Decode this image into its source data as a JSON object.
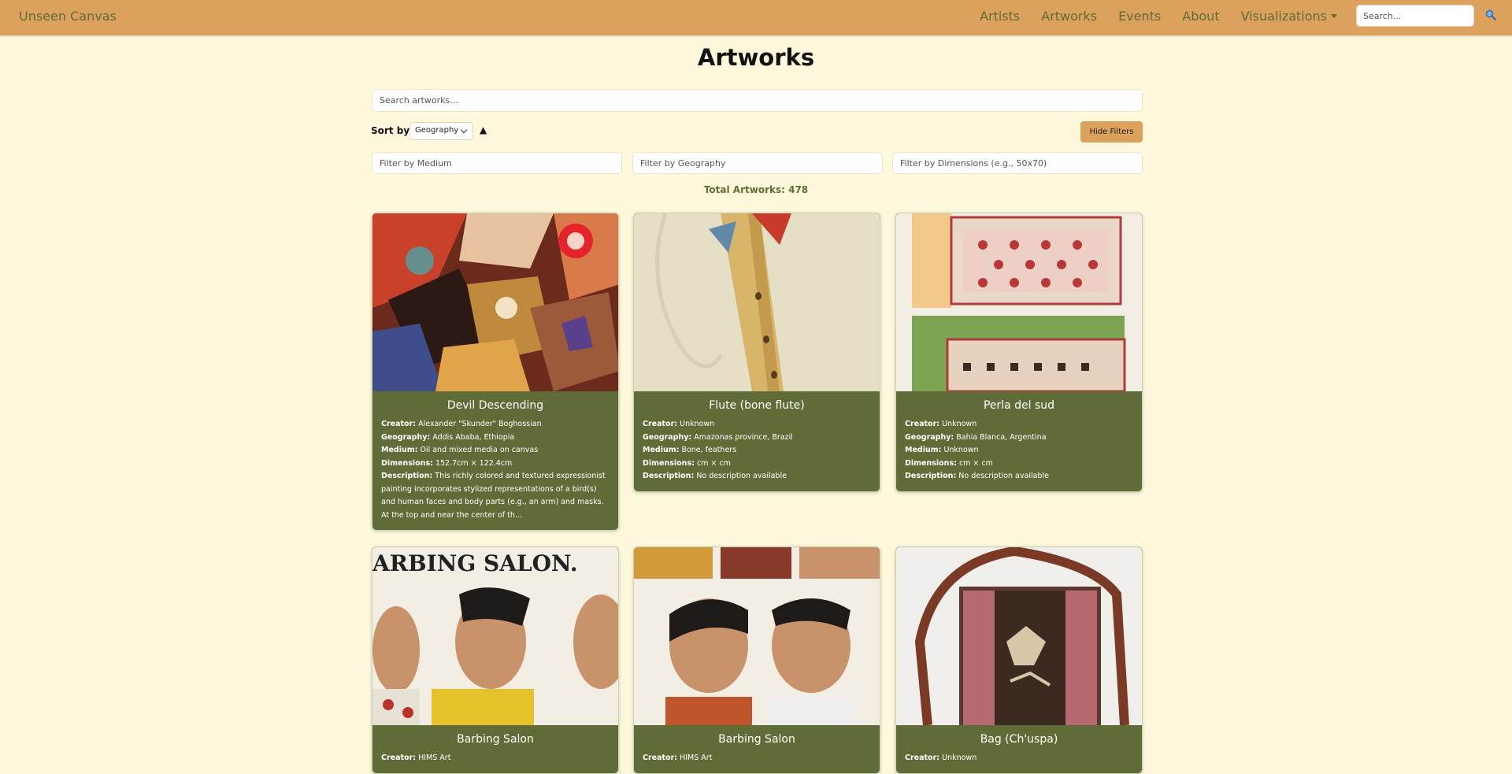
{
  "navbar": {
    "brand": "Unseen Canvas",
    "links": [
      "Artists",
      "Artworks",
      "Events",
      "About"
    ],
    "dropdown_label": "Visualizations",
    "search_placeholder": "Search...",
    "search_icon": "search-icon"
  },
  "main": {
    "title": "Artworks",
    "search_placeholder": "Search artworks...",
    "sort_label": "Sort by",
    "sort_value": "Geography",
    "sort_direction": "▲",
    "hide_filters_label": "Hide Filters",
    "filters": {
      "medium_placeholder": "Filter by Medium",
      "geography_placeholder": "Filter by Geography",
      "dimensions_placeholder": "Filter by Dimensions (e.g., 50x70)"
    },
    "total_label": "Total Artworks: 478"
  },
  "labels": {
    "creator": "Creator:",
    "geography": "Geography:",
    "medium": "Medium:",
    "dimensions": "Dimensions:",
    "description": "Description:"
  },
  "artworks": [
    {
      "title": "Devil Descending",
      "creator": "Alexander \"Skunder\" Boghossian",
      "geography": "Addis Ababa, Ethiopia",
      "medium": "Oil and mixed media on canvas",
      "dimensions": "152.7cm × 122.4cm",
      "description": "This richly colored and textured expressionist painting incorporates stylized representations of a bird(s) and human faces and body parts (e.g., an arm) and masks. At the top and near the center of th..."
    },
    {
      "title": "Flute (bone flute)",
      "creator": "Unknown",
      "geography": "Amazonas province, Brazil",
      "medium": "Bone, feathers",
      "dimensions": "cm × cm",
      "description": "No description available"
    },
    {
      "title": "Perla del sud",
      "creator": "Unknown",
      "geography": "Bahia Blanca, Argentina",
      "medium": "Unknown",
      "dimensions": "cm × cm",
      "description": "No description available"
    },
    {
      "title": "Barbing Salon",
      "creator": "HIMS Art"
    },
    {
      "title": "Barbing Salon",
      "creator": "HIMS Art"
    },
    {
      "title": "Bag (Ch'uspa)",
      "creator": "Unknown"
    }
  ],
  "colors": {
    "navbar": "#dda15e",
    "page_background": "#fef8dd",
    "card_body": "#606c38",
    "accent_text": "#606c38"
  }
}
